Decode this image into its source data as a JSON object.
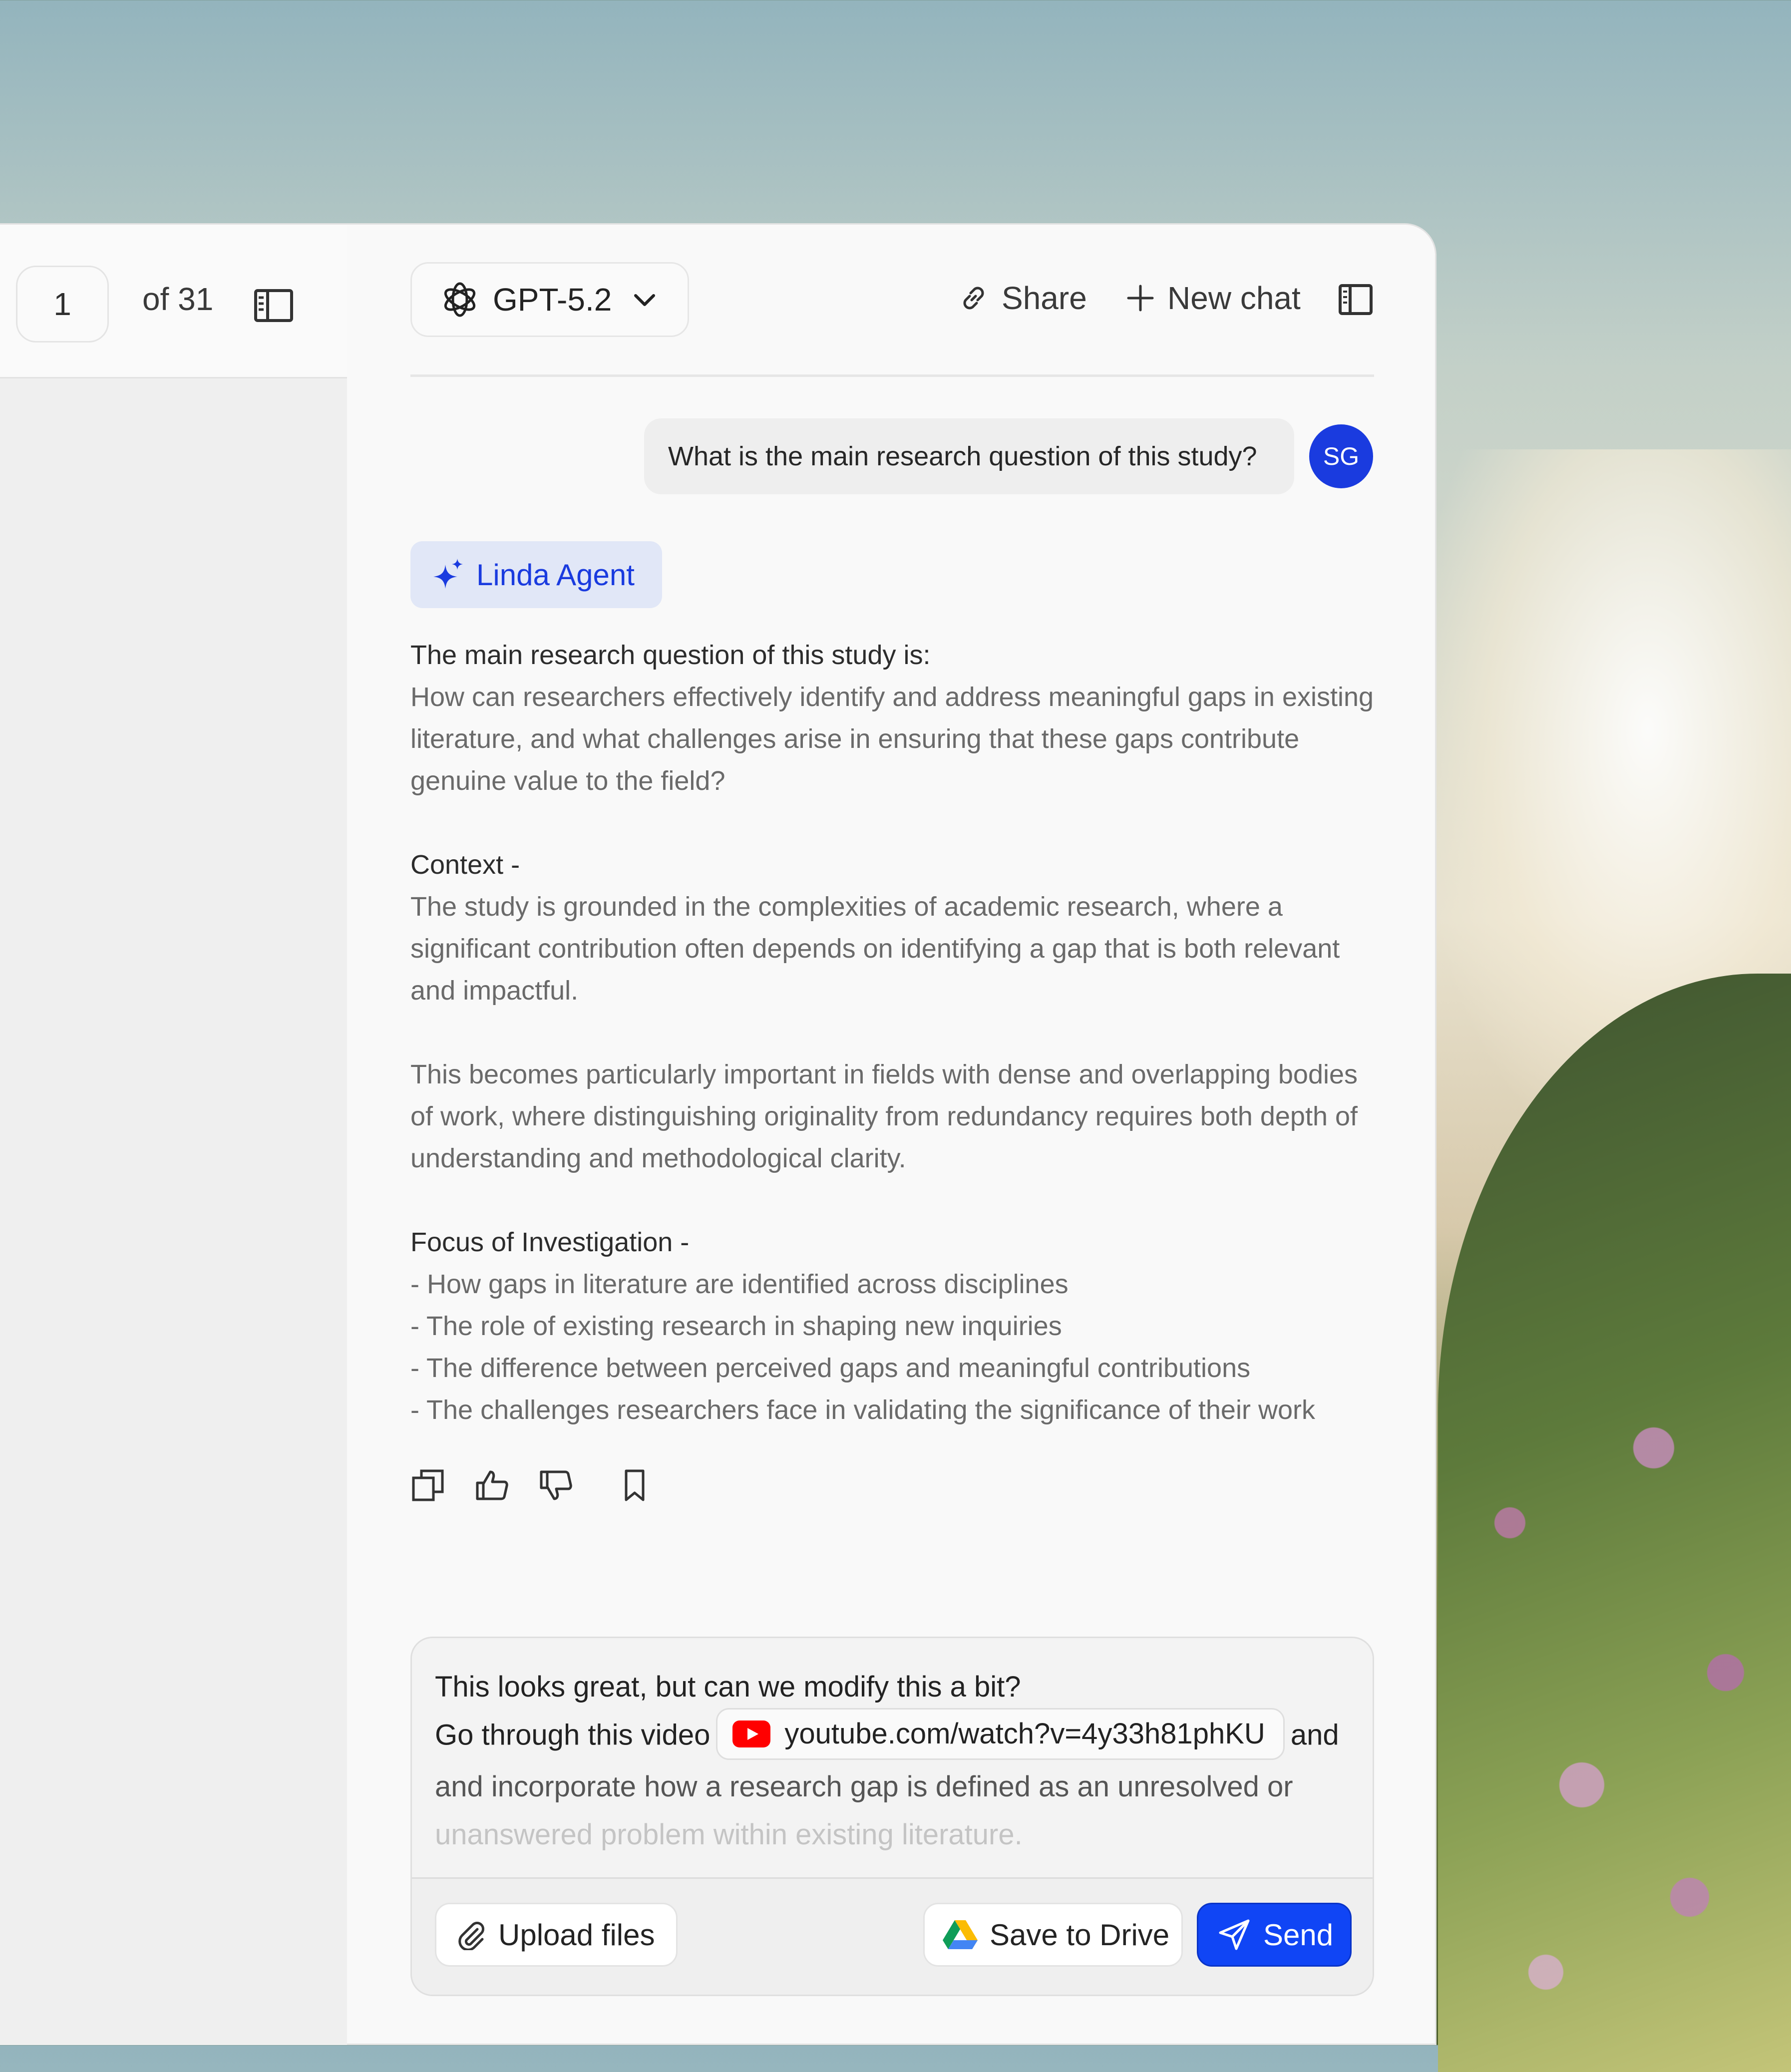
{
  "viewer": {
    "page_current": "1",
    "page_total_label": "of 31"
  },
  "header": {
    "model_label": "GPT-5.2",
    "share_label": "Share",
    "new_chat_label": "New chat"
  },
  "conversation": {
    "user_message": "What is the main research question of this study?",
    "user_initials": "SG",
    "agent_name": "Linda Agent",
    "answer": {
      "heading": "The main research question of this study is:",
      "question": "How can researchers effectively identify and address meaningful gaps in existing literature, and what challenges arise in ensuring that these gaps contribute genuine value to the field?",
      "context_heading": "Context -",
      "context_p1": "The study is grounded in the complexities of academic research, where a significant contribution often depends on identifying a gap that is both relevant and impactful.",
      "context_p2": "This becomes particularly important in fields with dense and overlapping bodies of work, where distinguishing originality from redundancy requires both depth of understanding and methodological clarity.",
      "focus_heading": "Focus of Investigation -",
      "focus_items": [
        "- How gaps in literature are identified across disciplines",
        "- The role of existing research in shaping new inquiries",
        "- The difference between perceived gaps and meaningful contributions",
        "- The challenges researchers face in validating the significance of their work"
      ]
    }
  },
  "composer": {
    "line1": "This looks great, but can we modify this a bit?",
    "line2_prefix": "Go through this video",
    "link_text": "youtube.com/watch?v=4y33h81phKU",
    "line2_suffix": "and",
    "line3": "and incorporate how a research gap is defined as an unresolved or",
    "line4": "unanswered problem within existing literature.",
    "upload_label": "Upload files",
    "drive_label": "Save to Drive",
    "send_label": "Send"
  },
  "colors": {
    "accent": "#1045f5",
    "avatar": "#1a3bdf",
    "agent_chip_bg": "#e1e7f7"
  }
}
